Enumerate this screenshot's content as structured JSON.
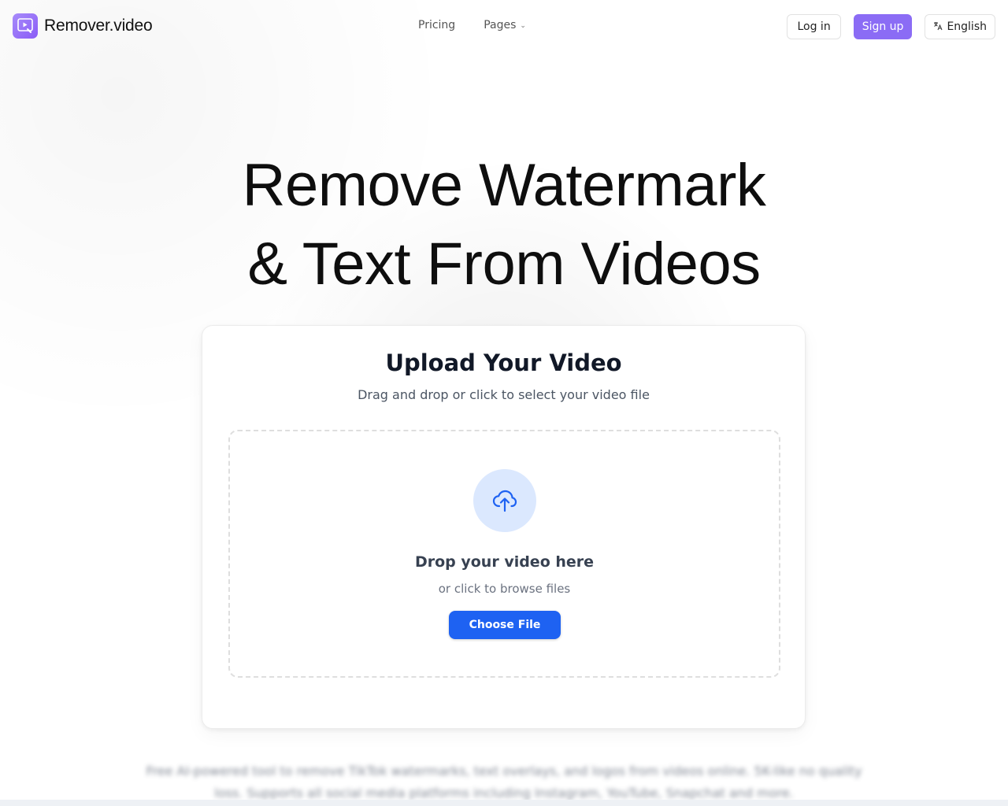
{
  "header": {
    "logo_text": "Remover.video",
    "nav": {
      "pricing": "Pricing",
      "pages": "Pages"
    },
    "login_label": "Log in",
    "signup_label": "Sign up",
    "language_label": "English"
  },
  "hero": {
    "title_line1": "Remove Watermark",
    "title_line2": "& Text From Videos"
  },
  "upload": {
    "title": "Upload Your Video",
    "subtitle": "Drag and drop or click to select your video file",
    "drop_title": "Drop your video here",
    "drop_subtitle": "or click to browse files",
    "choose_button": "Choose File"
  },
  "description": "Free AI-powered tool to remove TikTok watermarks, text overlays, and logos from videos online. 5K-like no quality loss. Supports all social media platforms including Instagram, YouTube, Snapchat and more.",
  "colors": {
    "accent_purple": "#8b6cf5",
    "primary_blue": "#1e62f2",
    "upload_circle": "#dbe8fe"
  },
  "icons": [
    "logo-icon",
    "chevron-down-icon",
    "translate-icon",
    "cloud-upload-icon"
  ]
}
